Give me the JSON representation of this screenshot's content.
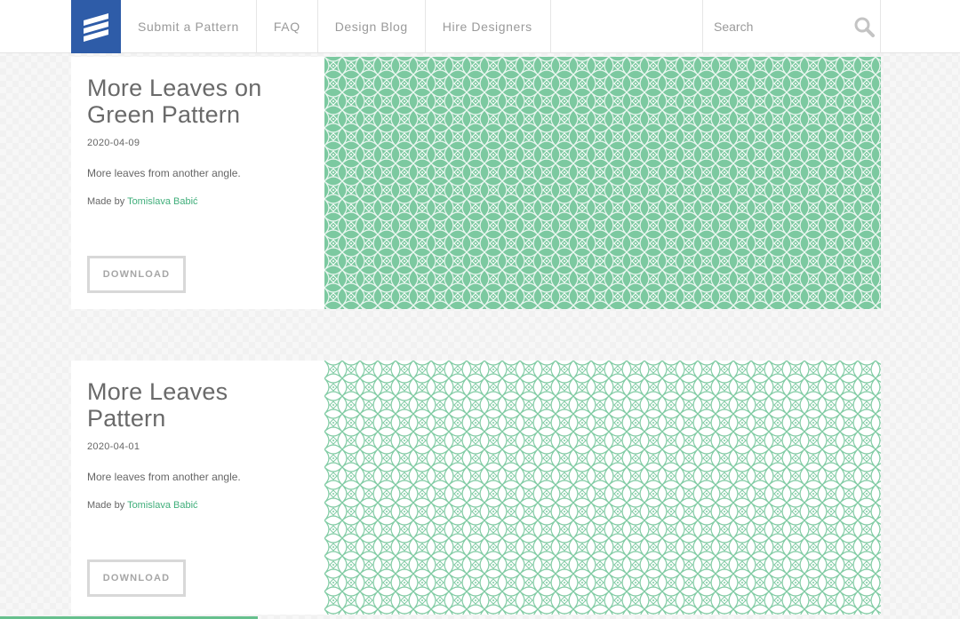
{
  "header": {
    "nav": [
      {
        "label": "Submit a Pattern"
      },
      {
        "label": "FAQ"
      },
      {
        "label": "Design Blog"
      },
      {
        "label": "Hire Designers"
      }
    ],
    "search": {
      "placeholder": "Search",
      "value": ""
    }
  },
  "patterns": [
    {
      "title": "More Leaves on Green Pattern",
      "date": "2020-04-09",
      "description": "More leaves from another angle.",
      "author_prefix": "Made by",
      "author": "Tomislava Babić",
      "download_label": "DOWNLOAD",
      "background_color": "#7cc9a0",
      "line_color": "#ffffff"
    },
    {
      "title": "More Leaves Pattern",
      "date": "2020-04-01",
      "description": "More leaves from another angle.",
      "author_prefix": "Made by",
      "author": "Tomislava Babić",
      "download_label": "DOWNLOAD",
      "background_color": "#ffffff",
      "line_color": "#80cba3"
    }
  ],
  "colors": {
    "brand": "#2e5ca8",
    "accent": "#3fae7a"
  },
  "icons": {
    "logo": "stacked-stripes-logo",
    "search": "magnifier-icon"
  }
}
